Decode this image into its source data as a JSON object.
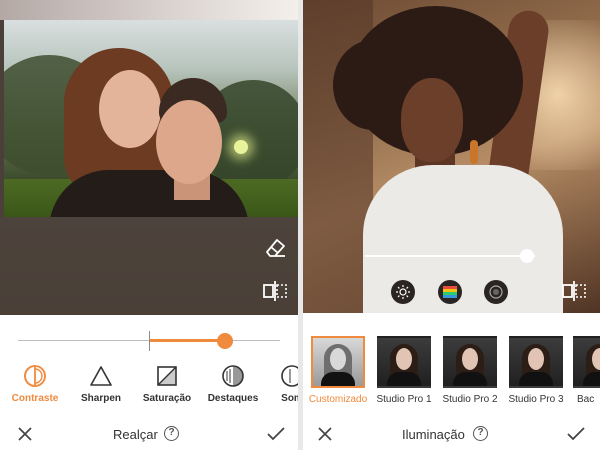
{
  "left_panel": {
    "tools": [
      {
        "label": "Contraste",
        "icon": "contrast-icon",
        "active": true
      },
      {
        "label": "Sharpen",
        "icon": "sharpen-triangle-icon",
        "active": false
      },
      {
        "label": "Saturação",
        "icon": "saturation-icon",
        "active": false
      },
      {
        "label": "Destaques",
        "icon": "highlights-icon",
        "active": false
      },
      {
        "label": "Som",
        "icon": "shadows-icon",
        "active": false
      }
    ],
    "slider": {
      "value": 0.79,
      "center": 0.5
    },
    "bottom_bar": {
      "title": "Realçar",
      "help": "?"
    },
    "overlay_icons": [
      "eraser-icon",
      "compare-icon"
    ]
  },
  "right_panel": {
    "slider": {
      "value": 0.95
    },
    "effect_buttons": [
      "brightness-icon",
      "color-wheel-icon",
      "vignette-icon"
    ],
    "presets": [
      {
        "label": "Customizado",
        "active": true
      },
      {
        "label": "Studio Pro 1",
        "active": false
      },
      {
        "label": "Studio Pro 2",
        "active": false
      },
      {
        "label": "Studio Pro 3",
        "active": false
      },
      {
        "label": "Bac",
        "active": false
      }
    ],
    "bottom_bar": {
      "title": "Iluminação",
      "help": "?"
    },
    "overlay_icons": [
      "compare-icon"
    ]
  },
  "colors": {
    "accent": "#f08a3c",
    "text": "#333333",
    "divider": "#e8e8e8"
  }
}
